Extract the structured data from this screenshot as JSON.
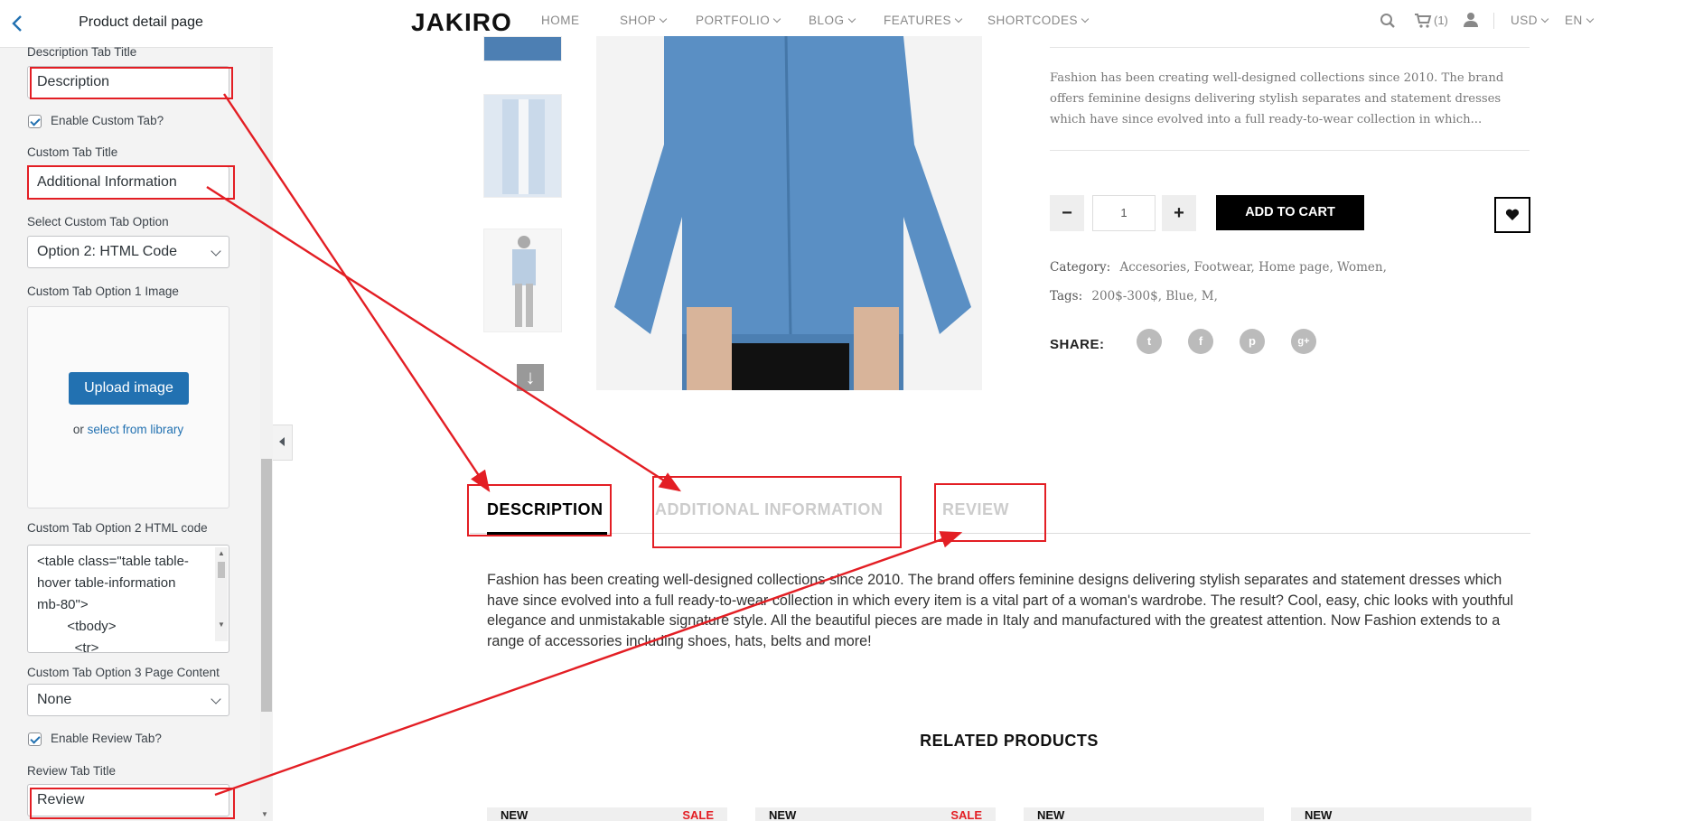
{
  "sidebar": {
    "back_icon": "chevron-left-icon",
    "title": "Product detail page",
    "desc_tab_title_label": "Description Tab Title",
    "desc_tab_title_value": "Description",
    "enable_custom_tab_label": "Enable Custom Tab?",
    "enable_custom_tab_checked": true,
    "custom_tab_title_label": "Custom Tab Title",
    "custom_tab_title_value": "Additional Information",
    "select_custom_tab_option_label": "Select Custom Tab Option",
    "select_custom_tab_option_value": "Option 2: HTML Code",
    "option1_image_label": "Custom Tab Option 1 Image",
    "upload_button": "Upload image",
    "or_text": "or",
    "select_library_link": "select from library",
    "option2_html_label": "Custom Tab Option 2 HTML code",
    "option2_html_value": "<table class=\"table table-\nhover table-information\nmb-80\">\n        <tbody>\n          <tr>",
    "option3_page_label": "Custom Tab Option 3 Page Content",
    "option3_page_value": "None",
    "enable_review_tab_label": "Enable Review Tab?",
    "enable_review_tab_checked": true,
    "review_tab_title_label": "Review Tab Title",
    "review_tab_title_value": "Review"
  },
  "header": {
    "logo": "JAKIRO",
    "nav": [
      {
        "label": "HOME",
        "has_dropdown": false
      },
      {
        "label": "SHOP",
        "has_dropdown": true
      },
      {
        "label": "PORTFOLIO",
        "has_dropdown": true
      },
      {
        "label": "BLOG",
        "has_dropdown": true
      },
      {
        "label": "FEATURES",
        "has_dropdown": true
      },
      {
        "label": "SHORTCODES",
        "has_dropdown": true
      }
    ],
    "search_icon": "search-icon",
    "cart_icon": "cart-icon",
    "cart_count": "(1)",
    "user_icon": "user-icon",
    "currency": "USD",
    "language": "EN"
  },
  "product": {
    "short_description": "Fashion has been creating well-designed collections since 2010. The brand offers feminine designs delivering stylish separates and statement dresses which have since evolved into a full ready-to-wear collection in which...",
    "quantity": "1",
    "minus_label": "−",
    "plus_label": "+",
    "add_to_cart": "ADD TO CART",
    "wishlist_icon": "heart-icon",
    "category_label": "Category:",
    "categories": "Accesories, Footwear, Home page, Women,",
    "tags_label": "Tags:",
    "tags": "200$-300$, Blue, M,",
    "share_label": "SHARE:",
    "share_icons": [
      "twitter-icon",
      "facebook-icon",
      "pinterest-icon",
      "google-plus-icon"
    ],
    "down_arrow": "↓"
  },
  "tabs": {
    "items": [
      {
        "label": "DESCRIPTION",
        "active": true
      },
      {
        "label": "ADDITIONAL INFORMATION",
        "active": false
      },
      {
        "label": "REVIEW",
        "active": false
      }
    ],
    "description_text": "Fashion has been creating well-designed collections since 2010. The brand offers feminine designs delivering stylish separates and statement dresses which have since evolved into a full ready-to-wear collection in which every item is a vital part of a woman's wardrobe. The result? Cool, easy, chic looks with youthful elegance and unmistakable signature style. All the beautiful pieces are made in Italy and manufactured with the greatest attention. Now Fashion extends to a range of accessories including shoes, hats, belts and more!"
  },
  "related": {
    "title": "RELATED PRODUCTS",
    "cards": [
      {
        "badge": "NEW",
        "sale": "SALE"
      },
      {
        "badge": "NEW",
        "sale": "SALE"
      },
      {
        "badge": "NEW",
        "sale": ""
      },
      {
        "badge": "NEW",
        "sale": ""
      }
    ]
  },
  "colors": {
    "annotation_red": "#e31e24",
    "wp_blue": "#2271b1"
  }
}
